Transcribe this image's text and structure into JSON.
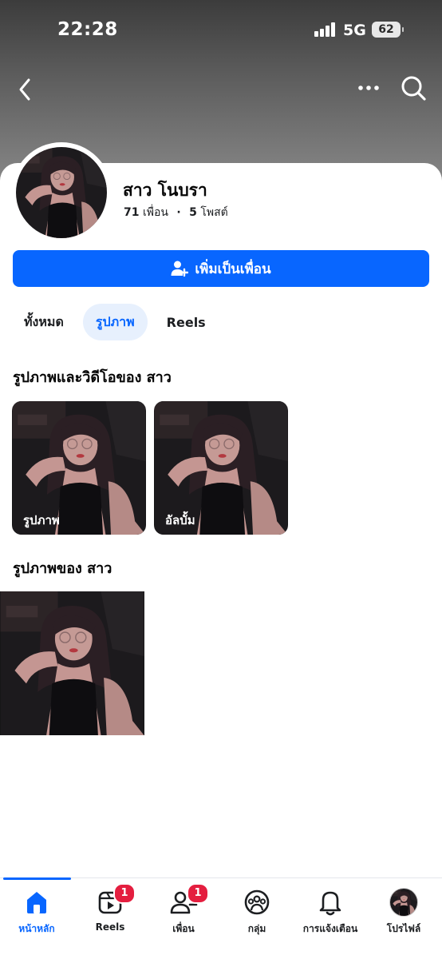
{
  "status_bar": {
    "time": "22:28",
    "network": "5G",
    "battery": "62"
  },
  "top_nav": {
    "back_icon": "chevron-left-icon",
    "more_icon": "more-dots-icon",
    "search_icon": "search-icon"
  },
  "profile": {
    "name": "สาว โนบรา",
    "friends_count": "71",
    "friends_label": "เพื่อน",
    "separator": "·",
    "posts_count": "5",
    "posts_label": "โพสต์"
  },
  "add_friend_button": {
    "label": "เพิ่มเป็นเพื่อน",
    "icon": "add-friend-icon"
  },
  "filter_tabs": [
    {
      "label": "ทั้งหมด",
      "active": false
    },
    {
      "label": "รูปภาพ",
      "active": true
    },
    {
      "label": "Reels",
      "active": false
    }
  ],
  "albums_section": {
    "title": "รูปภาพและวิดีโอของ สาว",
    "cards": [
      {
        "label": "รูปภาพ"
      },
      {
        "label": "อัลบั้ม"
      }
    ]
  },
  "photos_section": {
    "title": "รูปภาพของ สาว"
  },
  "bottom_tabs": [
    {
      "label": "หน้าหลัก",
      "icon": "home-icon",
      "active": true,
      "badge": ""
    },
    {
      "label": "Reels",
      "icon": "reels-icon",
      "active": false,
      "badge": "1"
    },
    {
      "label": "เพื่อน",
      "icon": "friends-icon",
      "active": false,
      "badge": "1"
    },
    {
      "label": "กลุ่ม",
      "icon": "groups-icon",
      "active": false,
      "badge": ""
    },
    {
      "label": "การแจ้งเตือน",
      "icon": "bell-icon",
      "active": false,
      "badge": ""
    },
    {
      "label": "โปรไฟล์",
      "icon": "profile-avatar",
      "active": false,
      "badge": ""
    }
  ],
  "colors": {
    "accent": "#0866ff",
    "badge": "#e41e3f",
    "active_tab_bg": "#e7f0fd"
  }
}
